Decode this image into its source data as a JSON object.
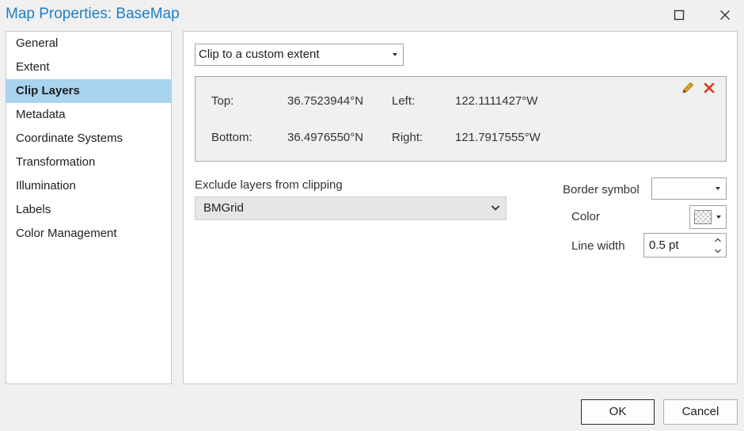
{
  "window": {
    "title": "Map Properties: BaseMap"
  },
  "nav": {
    "items": [
      {
        "label": "General"
      },
      {
        "label": "Extent"
      },
      {
        "label": "Clip Layers",
        "selected": true
      },
      {
        "label": "Metadata"
      },
      {
        "label": "Coordinate Systems"
      },
      {
        "label": "Transformation"
      },
      {
        "label": "Illumination"
      },
      {
        "label": "Labels"
      },
      {
        "label": "Color Management"
      }
    ]
  },
  "clip": {
    "mode_value": "Clip to a custom extent",
    "extent": {
      "top_label": "Top:",
      "top_value": "36.7523944°N",
      "left_label": "Left:",
      "left_value": "122.1111427°W",
      "bottom_label": "Bottom:",
      "bottom_value": "36.4976550°N",
      "right_label": "Right:",
      "right_value": "121.7917555°W"
    },
    "exclude_label": "Exclude layers from clipping",
    "exclude_value": "BMGrid",
    "border_symbol_label": "Border symbol",
    "border_symbol_value": "",
    "color_label": "Color",
    "line_width_label": "Line width",
    "line_width_value": "0.5 pt"
  },
  "buttons": {
    "ok": "OK",
    "cancel": "Cancel"
  },
  "colors": {
    "title": "#1f7fc4",
    "nav_selected": "#a9d3ef",
    "edit_icon": "#e3a21a",
    "delete_icon": "#d9381e"
  },
  "icons": {
    "maximize": "maximize-icon",
    "close": "close-icon",
    "edit": "pencil-icon",
    "delete": "delete-x-icon",
    "dropdown": "chevron-down-icon"
  }
}
